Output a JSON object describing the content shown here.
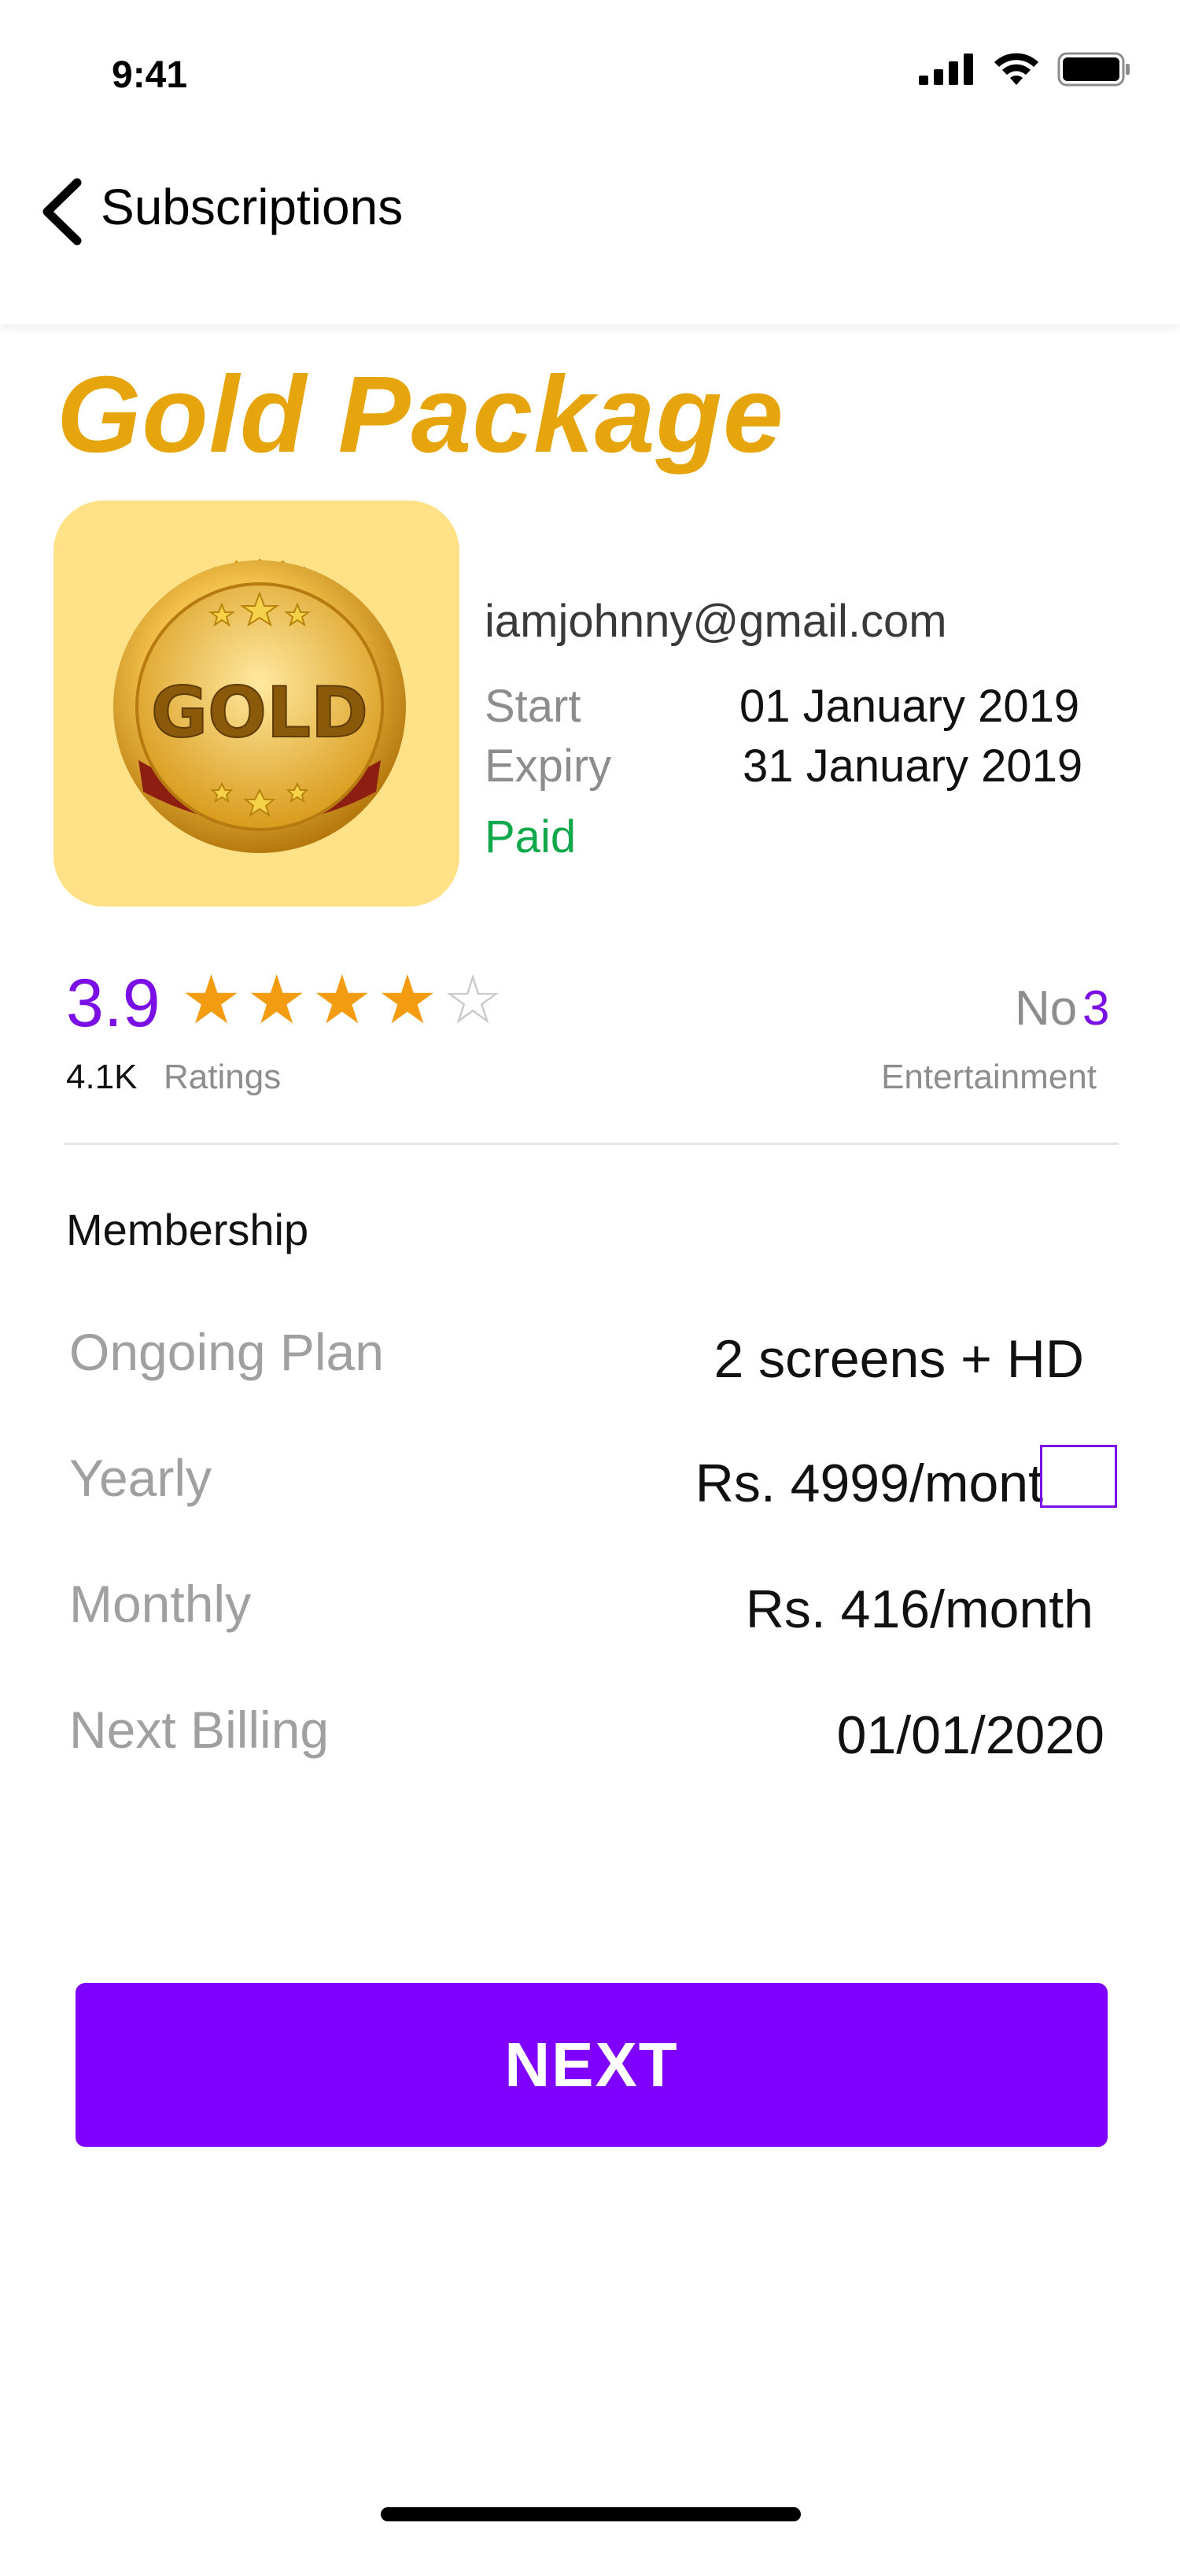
{
  "status_bar": {
    "time": "9:41"
  },
  "nav": {
    "back_label": "Subscriptions"
  },
  "package": {
    "title": "Gold Package",
    "badge_text": "GOLD",
    "email": "iamjohnny@gmail.com",
    "start_label": "Start",
    "start_value": "01 January 2019",
    "expiry_label": "Expiry",
    "expiry_value": "31 January 2019",
    "status": "Paid",
    "colors": {
      "title": "#e6a50c",
      "image_bg": "#ffe187",
      "paid": "#11a84b"
    }
  },
  "rating": {
    "value": "3.9",
    "stars_filled": 4,
    "stars_total": 5,
    "count": "4.1K",
    "count_label": "Ratings",
    "rank_prefix": "No",
    "rank_number": "3",
    "category": "Entertainment"
  },
  "membership": {
    "section_title": "Membership",
    "rows": [
      {
        "label": "Ongoing Plan",
        "value": "2 screens + HD"
      },
      {
        "label": "Yearly",
        "value": "Rs. 4999/mont"
      },
      {
        "label": "Monthly",
        "value": "Rs. 416/month"
      },
      {
        "label": "Next Billing",
        "value": "01/01/2020"
      }
    ]
  },
  "actions": {
    "next_label": "NEXT"
  },
  "accent_color": "#7f00ff"
}
